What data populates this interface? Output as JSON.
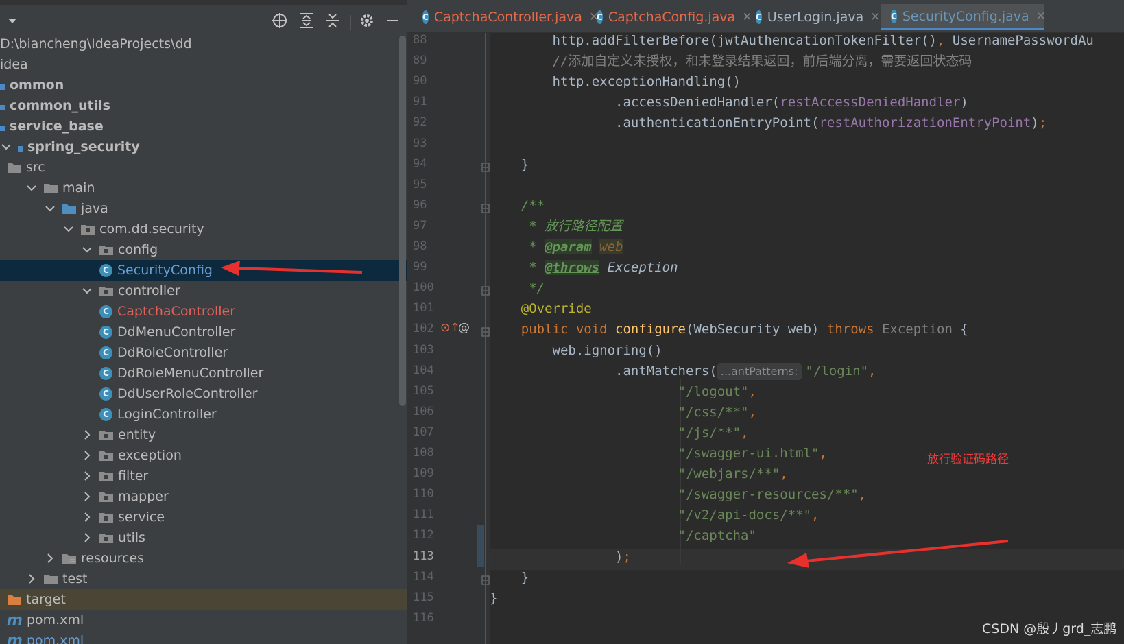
{
  "project": {
    "toolbar_icons": [
      "dropdown-icon",
      "locate-icon",
      "expand-all-icon",
      "collapse-all-icon",
      "gear-icon",
      "minimize-icon"
    ],
    "tree": [
      {
        "label": "D:\\biancheng\\IdeaProjects\\dd",
        "type": "path"
      },
      {
        "label": "idea",
        "type": "folder-text"
      },
      {
        "label": "ommon",
        "type": "module",
        "bold": true
      },
      {
        "label": "common_utils",
        "type": "module",
        "bold": true
      },
      {
        "label": "service_base",
        "type": "module",
        "bold": true
      },
      {
        "label": "spring_security",
        "type": "module",
        "bold": true
      },
      {
        "label": "src",
        "type": "folder"
      },
      {
        "label": "main",
        "type": "folder"
      },
      {
        "label": "java",
        "type": "folder"
      },
      {
        "label": "com.dd.security",
        "type": "package"
      },
      {
        "label": "config",
        "type": "package"
      },
      {
        "label": "SecurityConfig",
        "type": "class",
        "selected": true
      },
      {
        "label": "controller",
        "type": "package"
      },
      {
        "label": "CaptchaController",
        "type": "class",
        "modified": true
      },
      {
        "label": "DdMenuController",
        "type": "class"
      },
      {
        "label": "DdRoleController",
        "type": "class"
      },
      {
        "label": "DdRoleMenuController",
        "type": "class"
      },
      {
        "label": "DdUserRoleController",
        "type": "class"
      },
      {
        "label": "LoginController",
        "type": "class"
      },
      {
        "label": "entity",
        "type": "package"
      },
      {
        "label": "exception",
        "type": "package"
      },
      {
        "label": "filter",
        "type": "package"
      },
      {
        "label": "mapper",
        "type": "package"
      },
      {
        "label": "service",
        "type": "package"
      },
      {
        "label": "utils",
        "type": "package"
      },
      {
        "label": "resources",
        "type": "resources"
      },
      {
        "label": "test",
        "type": "folder"
      },
      {
        "label": "target",
        "type": "target"
      },
      {
        "label": "pom.xml",
        "type": "maven"
      },
      {
        "label": "pom.xml",
        "type": "maven"
      }
    ]
  },
  "tabs": [
    {
      "label": "CaptchaController.java",
      "state": "modified"
    },
    {
      "label": "CaptchaConfig.java",
      "state": "modified"
    },
    {
      "label": "UserLogin.java",
      "state": "plain"
    },
    {
      "label": "SecurityConfig.java",
      "state": "active"
    }
  ],
  "editor": {
    "line_numbers": [
      "88",
      "89",
      "90",
      "91",
      "92",
      "93",
      "94",
      "95",
      "96",
      "97",
      "98",
      "99",
      "100",
      "101",
      "102",
      "103",
      "104",
      "105",
      "106",
      "107",
      "108",
      "109",
      "110",
      "111",
      "112",
      "113",
      "114",
      "115",
      "116"
    ],
    "current_line": "113",
    "param_hint": "...antPatterns:",
    "gutter_markers": "⬆@"
  },
  "annotations": {
    "note": "放行验证码路径",
    "watermark": "CSDN @殷丿grd_志鹏"
  },
  "colors": {
    "selection": "#0d293e",
    "arrow": "#e8312d",
    "active_tab_underline": "#4a88c7"
  }
}
